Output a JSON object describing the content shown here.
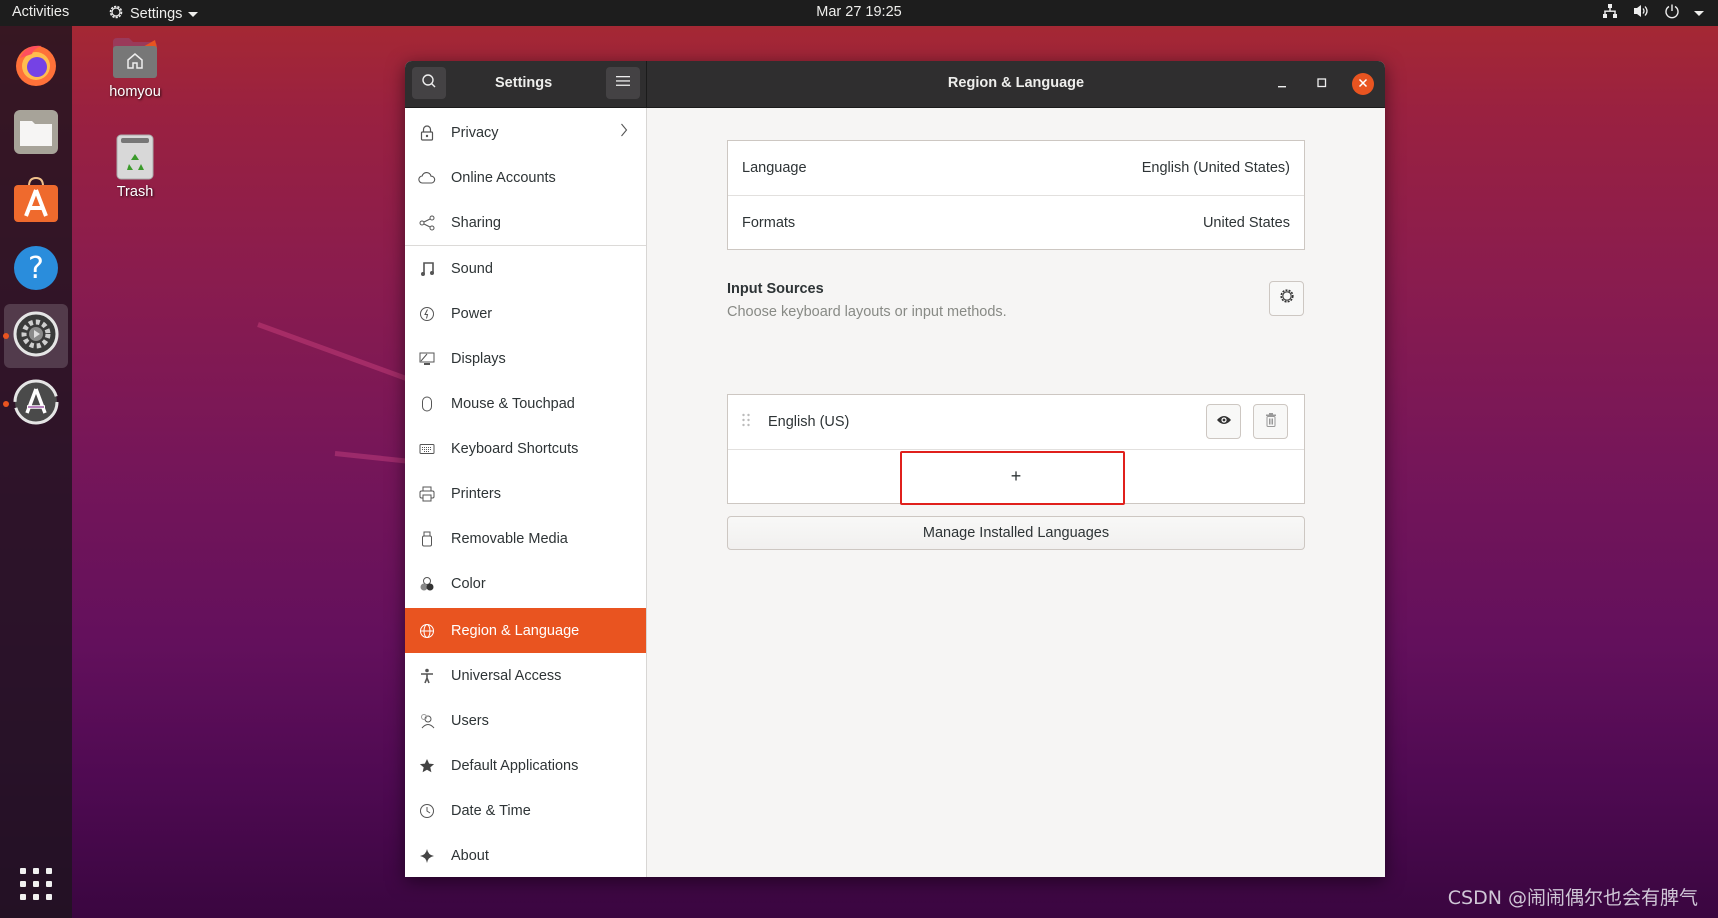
{
  "topbar": {
    "activities": "Activities",
    "app_menu": "Settings",
    "clock": "Mar 27  19:25",
    "tray_icons": [
      "network-icon",
      "volume-icon",
      "power-icon",
      "system-menu-caret"
    ]
  },
  "dock": {
    "items": [
      {
        "name": "Firefox",
        "icon": "firefox-icon",
        "running": false,
        "active": false
      },
      {
        "name": "Files",
        "icon": "files-icon",
        "running": false,
        "active": false
      },
      {
        "name": "Ubuntu Software",
        "icon": "software-icon",
        "running": false,
        "active": false
      },
      {
        "name": "Help",
        "icon": "help-icon",
        "running": false,
        "active": false
      },
      {
        "name": "Settings",
        "icon": "settings-icon",
        "running": true,
        "active": true
      },
      {
        "name": "Software Updater",
        "icon": "updater-icon",
        "running": true,
        "active": false
      }
    ],
    "show_apps": "show-applications-icon"
  },
  "desktop": {
    "icons": [
      {
        "label": "homyou",
        "icon": "home-folder-icon"
      },
      {
        "label": "Trash",
        "icon": "trash-icon"
      }
    ]
  },
  "window": {
    "sidebar_title": "Settings",
    "page_title": "Region & Language",
    "colors": {
      "accent": "#e95420",
      "highlight_box": "#e0201c"
    }
  },
  "sidebar": {
    "items": [
      {
        "label": "Privacy",
        "icon": "lock-icon",
        "has_submenu": true
      },
      {
        "label": "Online Accounts",
        "icon": "cloud-icon"
      },
      {
        "label": "Sharing",
        "icon": "share-icon"
      },
      {
        "label": "Sound",
        "icon": "music-note-icon"
      },
      {
        "label": "Power",
        "icon": "power-icon"
      },
      {
        "label": "Displays",
        "icon": "display-icon"
      },
      {
        "label": "Mouse & Touchpad",
        "icon": "mouse-icon"
      },
      {
        "label": "Keyboard Shortcuts",
        "icon": "keyboard-icon"
      },
      {
        "label": "Printers",
        "icon": "printer-icon"
      },
      {
        "label": "Removable Media",
        "icon": "usb-drive-icon"
      },
      {
        "label": "Color",
        "icon": "color-icon"
      },
      {
        "label": "Region & Language",
        "icon": "globe-icon",
        "selected": true
      },
      {
        "label": "Universal Access",
        "icon": "accessibility-icon"
      },
      {
        "label": "Users",
        "icon": "users-icon"
      },
      {
        "label": "Default Applications",
        "icon": "star-icon"
      },
      {
        "label": "Date & Time",
        "icon": "clock-icon"
      },
      {
        "label": "About",
        "icon": "sparkle-icon"
      }
    ]
  },
  "region": {
    "rows": [
      {
        "label": "Language",
        "value": "English (United States)"
      },
      {
        "label": "Formats",
        "value": "United States"
      }
    ],
    "input_sources": {
      "title": "Input Sources",
      "subtitle": "Choose keyboard layouts or input methods.",
      "items": [
        {
          "label": "English (US)"
        }
      ],
      "add_label": "+"
    },
    "manage_button": "Manage Installed Languages"
  },
  "watermark": "CSDN @闹闹偶尔也会有脾气"
}
